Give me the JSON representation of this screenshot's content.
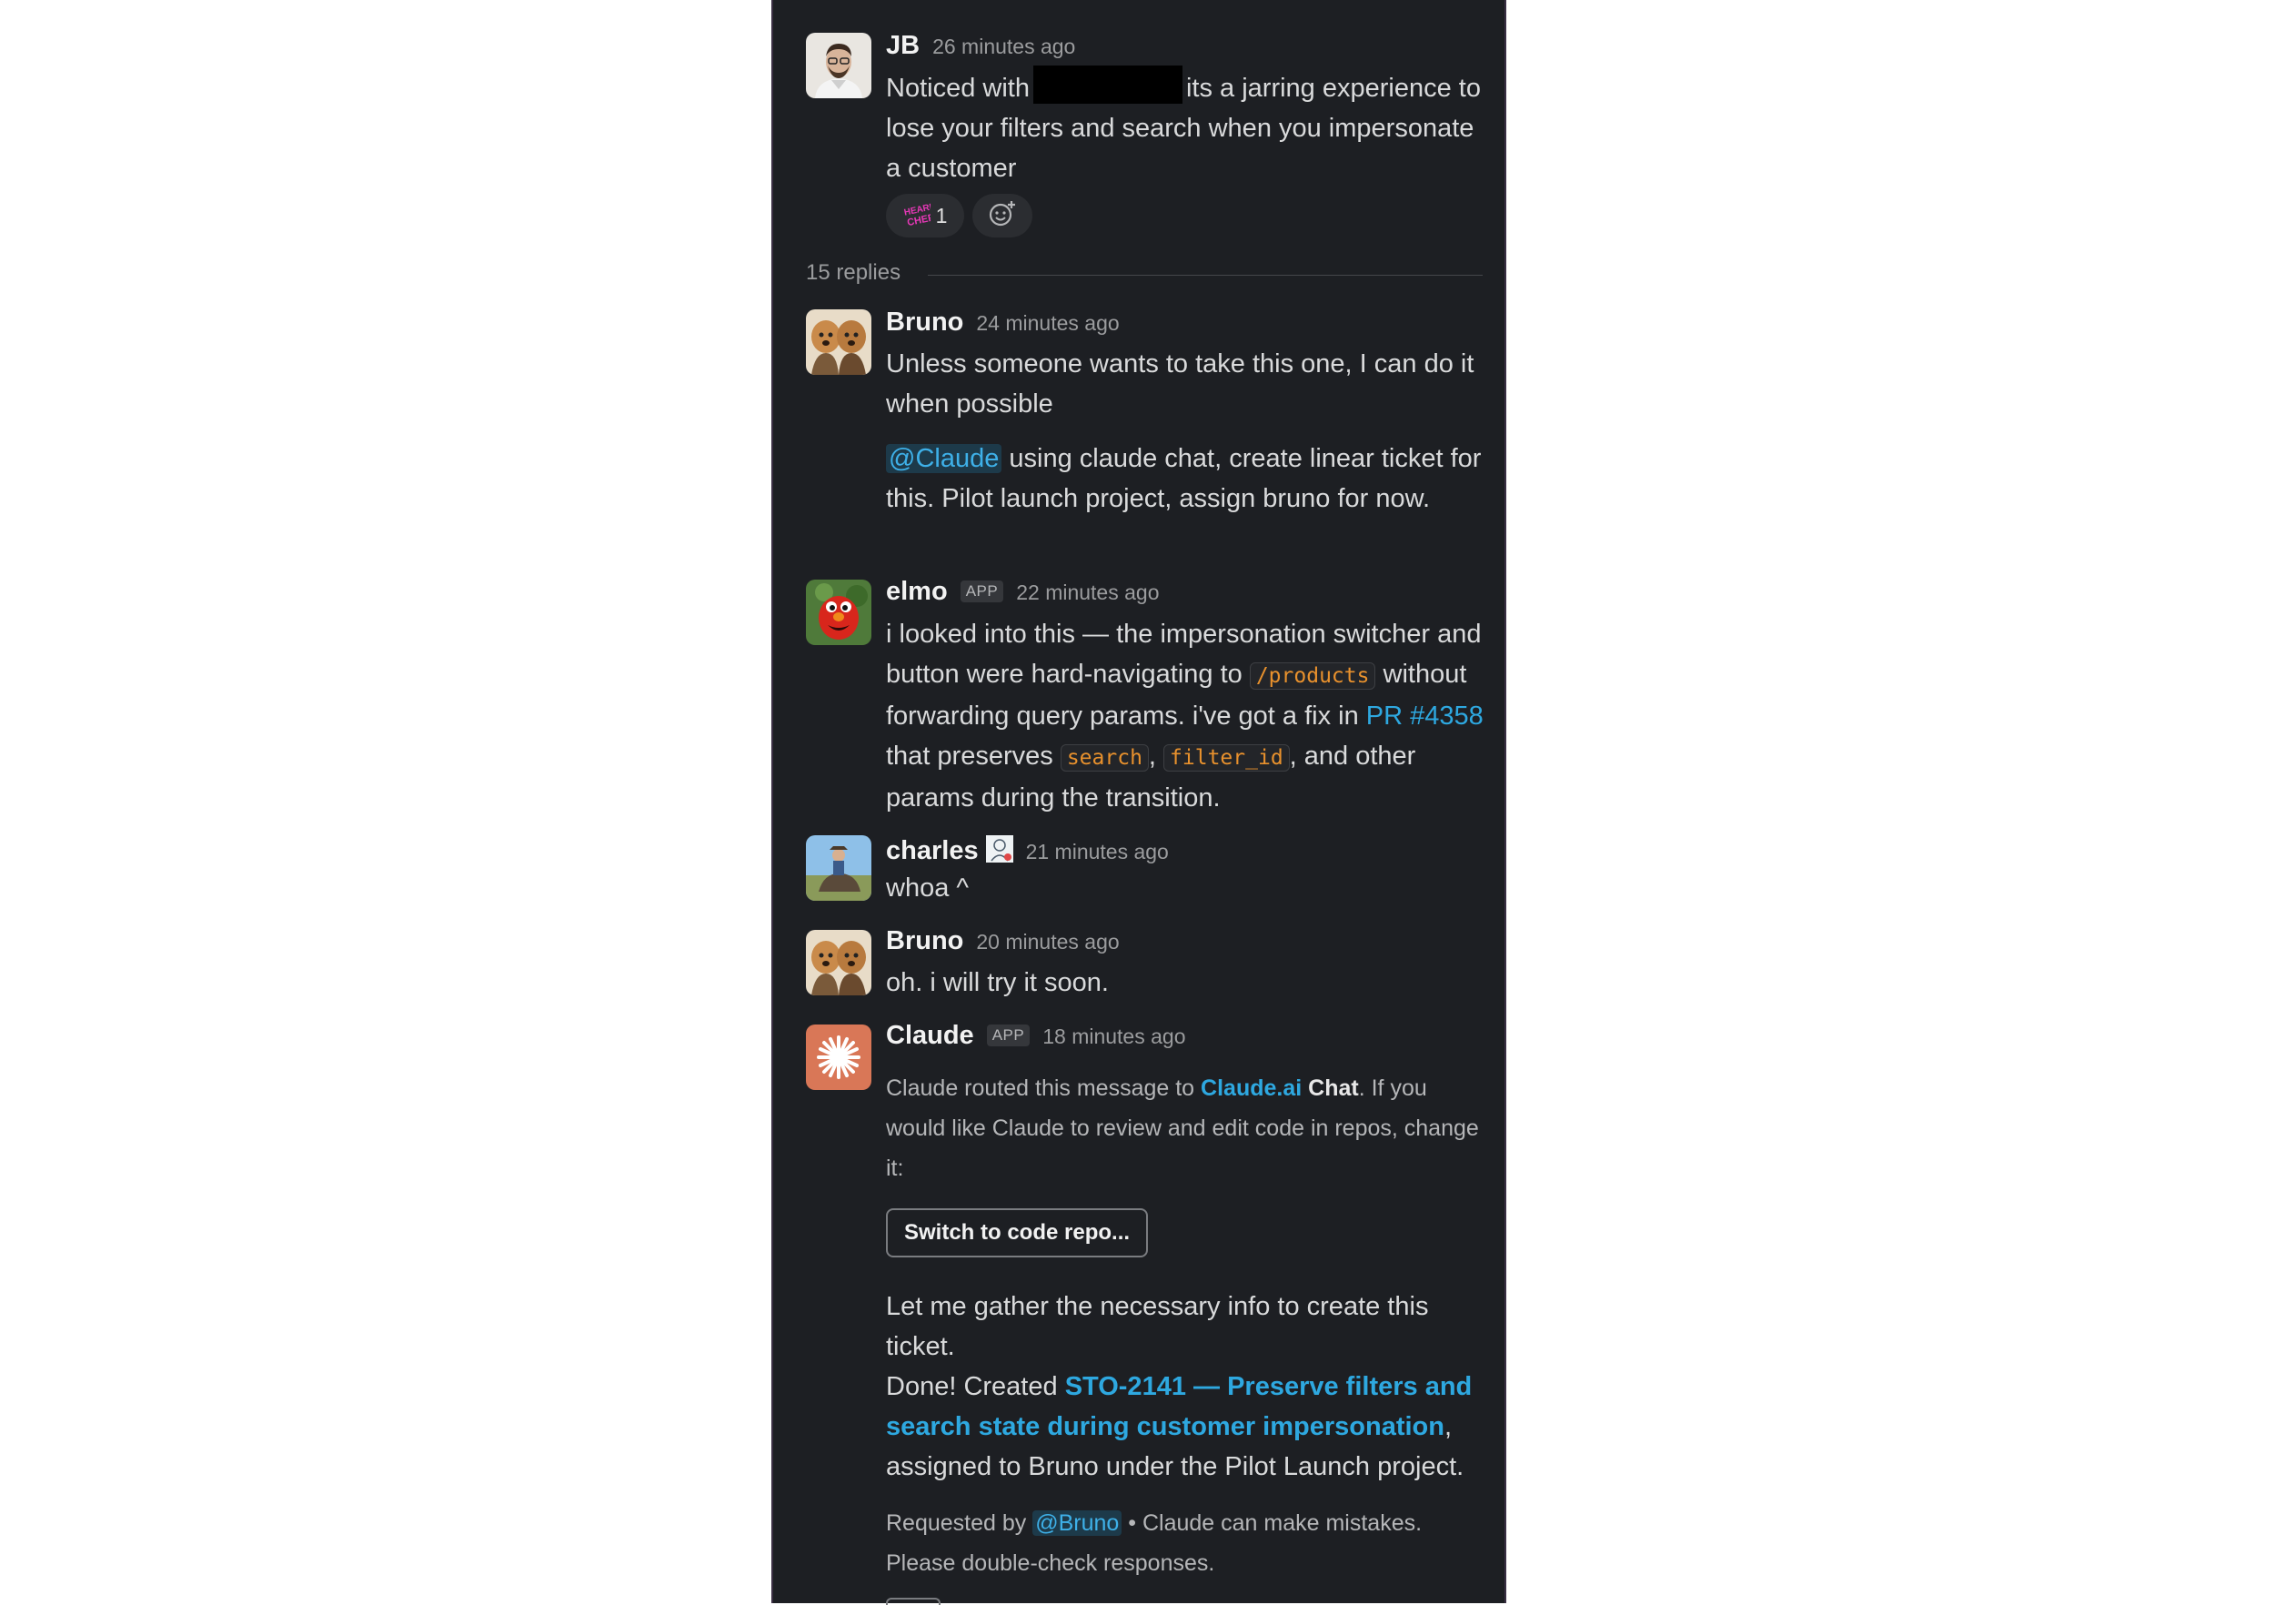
{
  "thread": {
    "parent": {
      "author": "JB",
      "time": "26 minutes ago",
      "text_before": "Noticed with",
      "text_after": "its a jarring experience to lose your filters and search when you impersonate a customer",
      "reaction_count": "1"
    },
    "replies_label": "15 replies",
    "messages": [
      {
        "author": "Bruno",
        "time": "24 minutes ago",
        "text": "Unless someone wants to take this one, I can do it when possible",
        "mention": "@Claude",
        "text2": "using claude chat, create linear ticket for this. Pilot launch project, assign bruno for now."
      },
      {
        "author": "elmo",
        "badge": "APP",
        "time": "22 minutes ago",
        "t1": "i looked into this — the impersonation switcher and button were hard-navigating to",
        "code1": "/products",
        "t2": "without forwarding query params. i've got a fix in",
        "link": "PR #4358",
        "t3": "that preserves",
        "code2": "search",
        "t4": ",",
        "code3": "filter_id",
        "t5": ", and other params during the transition."
      },
      {
        "author": "charles",
        "time": "21 minutes ago",
        "text": "whoa ^"
      },
      {
        "author": "Bruno",
        "time": "20 minutes ago",
        "text": "oh. i will try it soon."
      },
      {
        "author": "Claude",
        "badge": "APP",
        "time": "18 minutes ago",
        "route1": "Claude routed this message to",
        "route_link": "Claude.ai",
        "route_bold": "Chat",
        "route2": ". If you would like Claude to review and edit code in repos, change it:",
        "button": "Switch to code repo...",
        "gather": "Let me gather the necessary info to create this ticket.",
        "done": "Done! Created",
        "ticket": "STO-2141 — Preserve filters and search state during customer impersonation",
        "assigned": ", assigned to Bruno under the Pilot Launch project.",
        "requested_by": "Requested by",
        "requester": "@Bruno",
        "disclaimer": "• Claude can make mistakes. Please double-check responses."
      }
    ]
  },
  "colors": {
    "panel_bg": "#1d1f23",
    "link": "#2ea8e0",
    "code": "#e8912d",
    "claude_brand": "#d97757"
  }
}
